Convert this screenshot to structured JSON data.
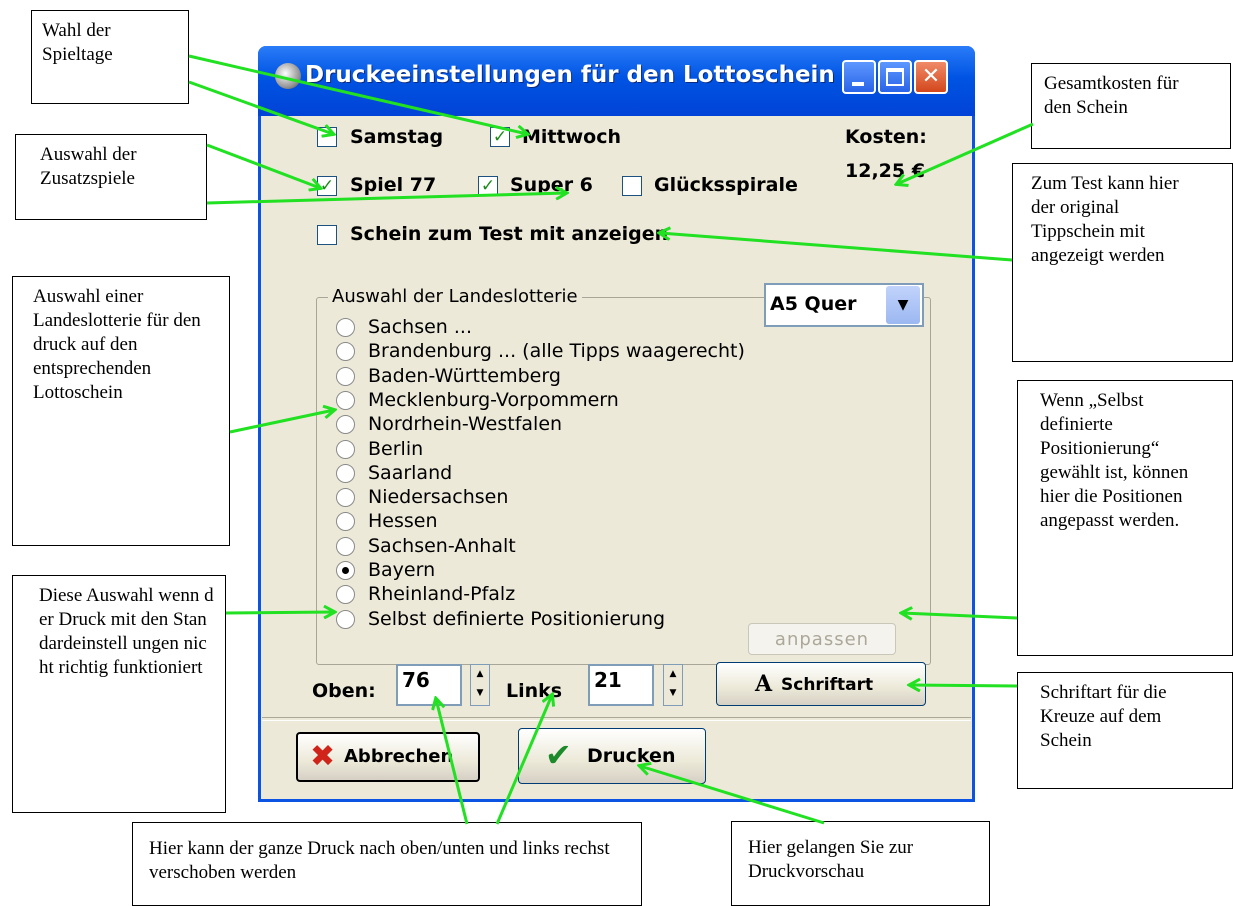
{
  "window": {
    "title": "Druckeeinstellungen für den Lottoschein"
  },
  "spieltage": {
    "samstag": {
      "label": "Samstag",
      "checked": false
    },
    "mittwoch": {
      "label": "Mittwoch",
      "checked": true
    }
  },
  "kosten": {
    "label": "Kosten:",
    "value": "12,25 €"
  },
  "zusatzspiele": {
    "spiel77": {
      "label": "Spiel 77",
      "checked": true
    },
    "super6": {
      "label": "Super 6",
      "checked": true
    },
    "gluecksspirale": {
      "label": "Glücksspirale",
      "checked": false
    }
  },
  "test": {
    "label": "Schein zum Test mit anzeigen",
    "checked": false
  },
  "lotterie": {
    "group_title": "Auswahl der Landeslotterie",
    "format": "A5 Quer",
    "options": [
      {
        "label": "Sachsen ...",
        "selected": false
      },
      {
        "label": "Brandenburg ... (alle Tipps waagerecht)",
        "selected": false
      },
      {
        "label": "Baden-Württemberg",
        "selected": false
      },
      {
        "label": "Mecklenburg-Vorpommern",
        "selected": false
      },
      {
        "label": "Nordrhein-Westfalen",
        "selected": false
      },
      {
        "label": "Berlin",
        "selected": false
      },
      {
        "label": "Saarland",
        "selected": false
      },
      {
        "label": "Niedersachsen",
        "selected": false
      },
      {
        "label": "Hessen",
        "selected": false
      },
      {
        "label": "Sachsen-Anhalt",
        "selected": false
      },
      {
        "label": "Bayern",
        "selected": true
      },
      {
        "label": "Rheinland-Pfalz",
        "selected": false
      },
      {
        "label": "Selbst definierte Positionierung",
        "selected": false
      }
    ],
    "adjust_label": "anpassen"
  },
  "offset": {
    "oben_label": "Oben:",
    "oben_value": "76",
    "links_label": "Links",
    "links_value": "21"
  },
  "buttons": {
    "schriftart": "Schriftart",
    "abbrechen": "Abbrechen",
    "drucken": "Drucken"
  },
  "notes": {
    "spieltage": "Wahl der Spieltage",
    "zusatzspiele": "Auswahl der Zusatzspiele",
    "landeslotterie": "Auswahl einer Landeslotterie für den druck auf den entsprechenden Lottoschein",
    "diese_auswahl": "Diese Auswahl wenn der Druck mit den Standardeinstell ungen nicht richtig funktioniert",
    "gesamtkosten": "Gesamtkosten für den Schein",
    "zum_test": "Zum Test kann hier der original Tippschein mit angezeigt werden",
    "wenn_selbst": "Wenn „Selbst definierte Positionierung“ gewählt ist, können hier die Positionen angepasst werden.",
    "schriftart": "Schriftart für die Kreuze auf dem Schein",
    "verschieben": "Hier kann der ganze Druck nach  oben/unten und links rechst verschoben werden",
    "vorschau": "Hier gelangen Sie zur Druckvorschau"
  },
  "colors": {
    "arrow": "#22e022",
    "titlebar": "#0054e3",
    "dialog": "#ece9d8"
  }
}
